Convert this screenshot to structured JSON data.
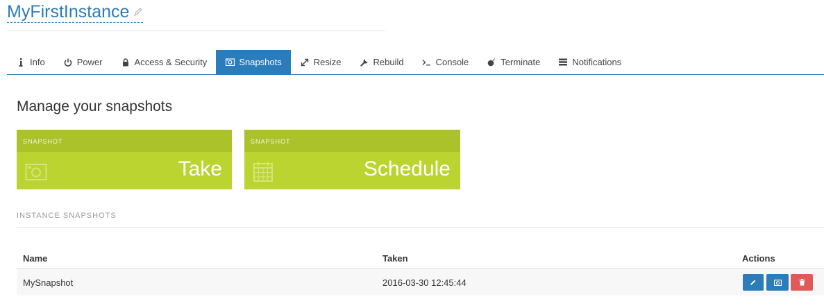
{
  "instance": {
    "name": "MyFirstInstance"
  },
  "tabs": [
    {
      "label": "Info",
      "icon": "info-icon"
    },
    {
      "label": "Power",
      "icon": "power-icon"
    },
    {
      "label": "Access & Security",
      "icon": "lock-icon"
    },
    {
      "label": "Snapshots",
      "icon": "camera-icon",
      "active": true
    },
    {
      "label": "Resize",
      "icon": "resize-icon"
    },
    {
      "label": "Rebuild",
      "icon": "wrench-icon"
    },
    {
      "label": "Console",
      "icon": "console-icon"
    },
    {
      "label": "Terminate",
      "icon": "bomb-icon"
    },
    {
      "label": "Notifications",
      "icon": "list-icon"
    }
  ],
  "section": {
    "title": "Manage your snapshots"
  },
  "cards": [
    {
      "kicker": "SNAPSHOT",
      "label": "Take",
      "icon": "camera-icon"
    },
    {
      "kicker": "SNAPSHOT",
      "label": "Schedule",
      "icon": "calendar-icon"
    }
  ],
  "snapshots": {
    "heading": "INSTANCE SNAPSHOTS",
    "columns": {
      "name": "Name",
      "taken": "Taken",
      "actions": "Actions"
    },
    "rows": [
      {
        "name": "MySnapshot",
        "taken": "2016-03-30 12:45:44",
        "actions": [
          "edit-icon",
          "camera-icon",
          "trash-icon"
        ]
      }
    ]
  },
  "colors": {
    "accent": "#2b7cba",
    "card": "#bcd42f",
    "card_header": "#abc22a",
    "danger": "#e05a5a"
  }
}
